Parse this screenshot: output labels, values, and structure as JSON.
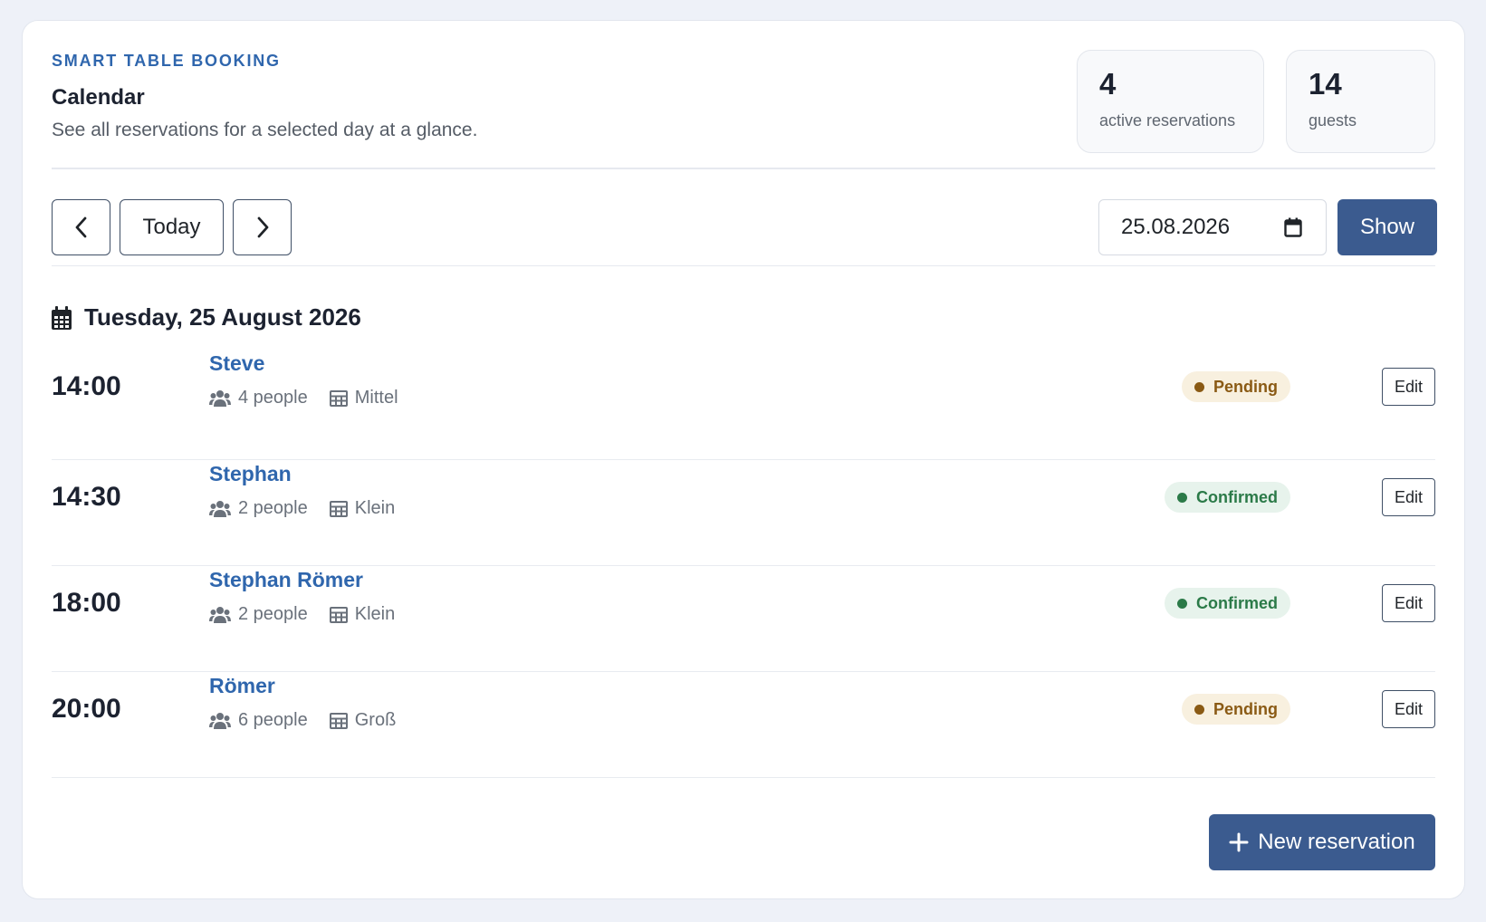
{
  "header": {
    "eyebrow": "SMART TABLE BOOKING",
    "title": "Calendar",
    "subtitle": "See all reservations for a selected day at a glance."
  },
  "stats": [
    {
      "value": "4",
      "label": "active reservations"
    },
    {
      "value": "14",
      "label": "guests"
    }
  ],
  "nav": {
    "prev_icon": "chevron-left-icon",
    "today_label": "Today",
    "next_icon": "chevron-right-icon"
  },
  "date_picker": {
    "value": "25.08.2026",
    "icon": "calendar-icon"
  },
  "show_label": "Show",
  "day_heading": "Tuesday, 25 August 2026",
  "reservations": [
    {
      "time": "14:00",
      "name": "Steve",
      "people": "4 people",
      "table": "Mittel",
      "status": "Pending",
      "edit": "Edit"
    },
    {
      "time": "14:30",
      "name": "Stephan",
      "people": "2 people",
      "table": "Klein",
      "status": "Confirmed",
      "edit": "Edit"
    },
    {
      "time": "18:00",
      "name": "Stephan Römer",
      "people": "2 people",
      "table": "Klein",
      "status": "Confirmed",
      "edit": "Edit"
    },
    {
      "time": "20:00",
      "name": "Römer",
      "people": "6 people",
      "table": "Groß",
      "status": "Pending",
      "edit": "Edit"
    }
  ],
  "new_reservation_label": "New reservation",
  "colors": {
    "accent": "#2f66ad",
    "primary_button": "#3b5b8f",
    "pending_text": "#8a5a14",
    "pending_bg": "#f8f0df",
    "confirmed_text": "#2b7a48",
    "confirmed_bg": "#e7f3ec"
  }
}
